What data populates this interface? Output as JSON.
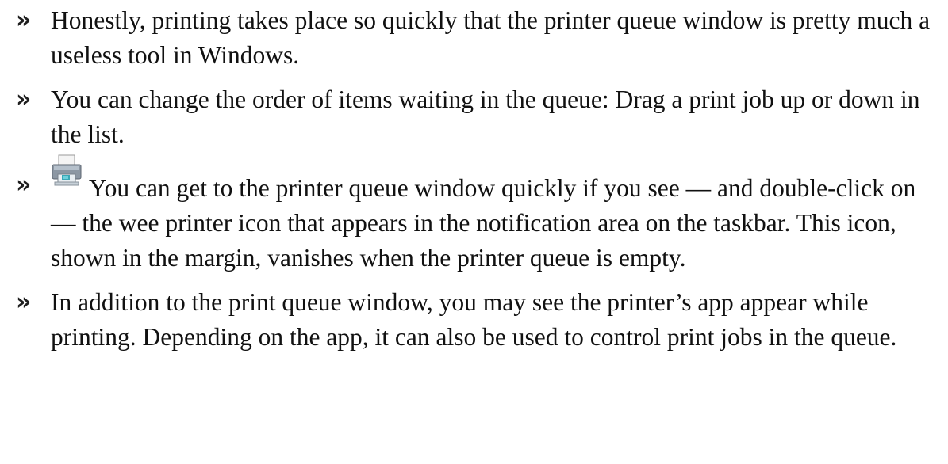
{
  "bullets": [
    {
      "marker": "»",
      "text": "Honestly, printing takes place so quickly that the printer queue window is pretty much a useless tool in Windows."
    },
    {
      "marker": "»",
      "text": "You can change the order of items waiting in the queue: Drag a print job up or down in the list."
    },
    {
      "marker": "»",
      "icon": "printer-icon",
      "text": "You can get to the printer queue window quickly if you see — and double-click on — the wee printer icon that appears in the notification area on the taskbar. This icon, shown in the margin, vanishes when the printer queue is empty."
    },
    {
      "marker": "»",
      "text": "In addition to the print queue window, you may see the printer’s app appear while printing. Depending on the app, it can also be used to control print jobs in the queue."
    }
  ]
}
